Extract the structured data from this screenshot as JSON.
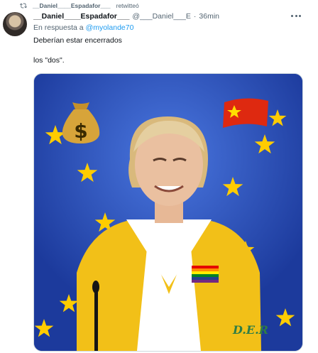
{
  "retweet": {
    "user": "__Daniel____Espadafor___",
    "action": "retwitteó",
    "icon": "retweet-icon"
  },
  "tweet": {
    "display_name": "__Daniel____Espadafor___",
    "handle": "@___Daniel___E",
    "separator": "·",
    "time": "36min",
    "reply_prefix": "En respuesta a",
    "reply_to": "@myolande70",
    "text_line1": "Deberían estar encerrados",
    "text_line2": "los \"dos\".",
    "more_icon": "more-icon"
  },
  "media": {
    "watermark": "D.E.R",
    "colors": {
      "eu_blue": "#2f56c7",
      "eu_star": "#ffcc00",
      "jacket": "#f2c018",
      "shirt": "#ffffff",
      "flag_red": "#de2910"
    }
  }
}
